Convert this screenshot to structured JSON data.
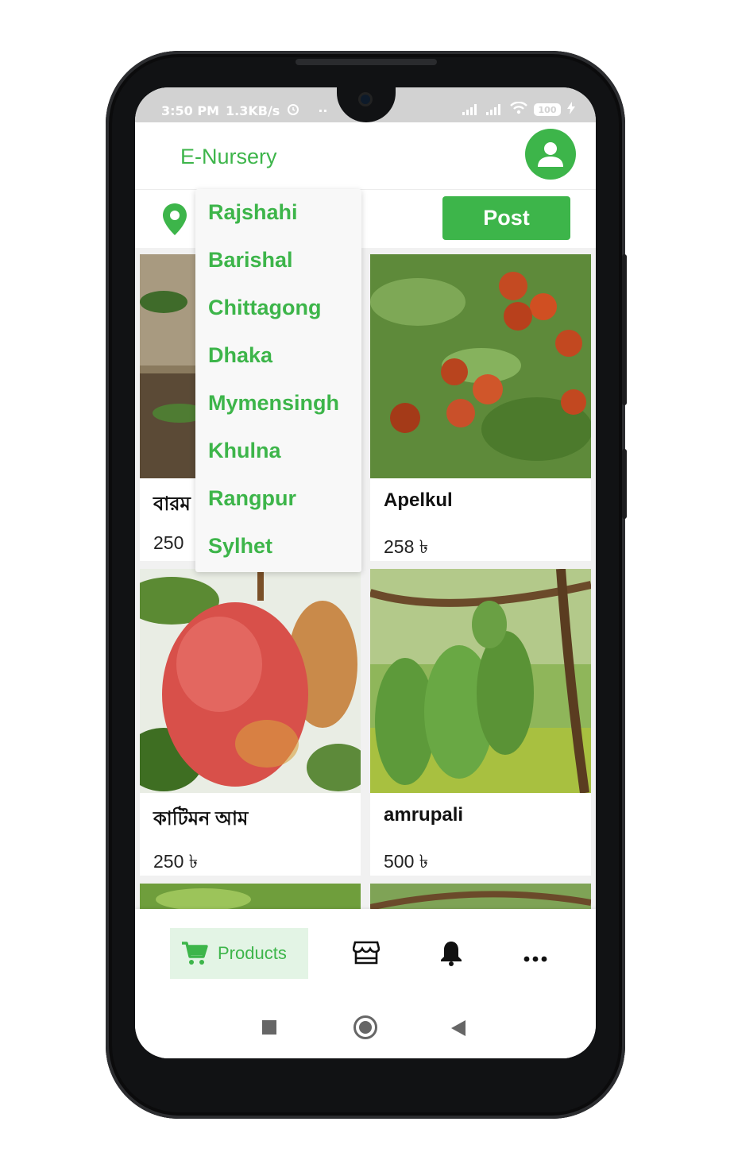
{
  "status_bar": {
    "time": "3:50 PM",
    "speed": "1.3KB/s",
    "dots": "··",
    "battery": "100"
  },
  "app_bar": {
    "title": "E-Nursery",
    "profile_icon": "account-icon"
  },
  "filter": {
    "location_icon": "map-pin-icon",
    "post_label": "Post"
  },
  "location_dropdown": {
    "options": [
      "Rajshahi",
      "Barishal",
      "Chittagong",
      "Dhaka",
      "Mymensingh",
      "Khulna",
      "Rangpur",
      "Sylhet"
    ]
  },
  "products": [
    {
      "name": "বারম",
      "price": "250"
    },
    {
      "name": "Apelkul",
      "price": "258 ৳"
    },
    {
      "name": "কাটিমন আম",
      "price": "250 ৳"
    },
    {
      "name": "amrupali",
      "price": "500 ৳"
    }
  ],
  "bottom_nav": {
    "products_label": "Products",
    "icons": [
      "cart-icon",
      "store-icon",
      "bell-icon",
      "more-icon"
    ]
  },
  "colors": {
    "accent": "#3db54a",
    "accent_light": "#e3f4e5"
  }
}
